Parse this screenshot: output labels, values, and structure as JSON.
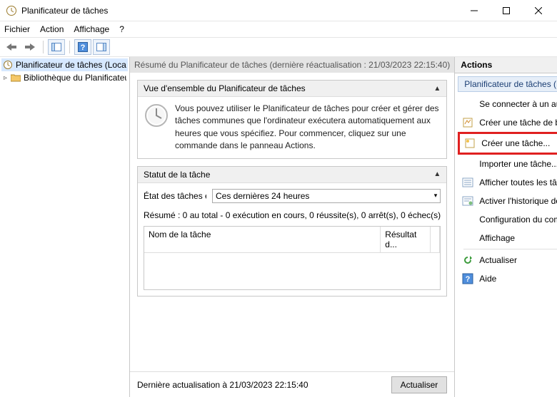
{
  "window": {
    "title": "Planificateur de tâches"
  },
  "menubar": {
    "file": "Fichier",
    "action": "Action",
    "view": "Affichage",
    "help": "?"
  },
  "tree": {
    "root": "Planificateur de tâches (Local)",
    "lib": "Bibliothèque du Planificateur de tâches"
  },
  "center": {
    "summaryHead": "Résumé du Planificateur de tâches (dernière réactualisation : 21/03/2023 22:15:40)",
    "overviewTitle": "Vue d'ensemble du Planificateur de tâches",
    "overviewText": "Vous pouvez utiliser le Planificateur de tâches pour créer et gérer des tâches communes que l'ordinateur exécutera automatiquement aux heures que vous spécifiez. Pour commencer, cliquez sur une commande dans le panneau Actions.",
    "statusTitle": "Statut de la tâche",
    "stateLabel": "État des tâches exécutées :",
    "periodSelected": "Ces dernières 24 heures",
    "summaryLine": "Résumé : 0 au total - 0 exécution en cours, 0 réussite(s), 0 arrêt(s), 0 échec(s)",
    "colName": "Nom de la tâche",
    "colResult": "Résultat d...",
    "lastRefresh": "Dernière actualisation à 21/03/2023 22:15:40",
    "refreshBtn": "Actualiser"
  },
  "actions": {
    "title": "Actions",
    "groupTitle": "Planificateur de tâches (Local)",
    "connect": "Se connecter à un autre ordinateur...",
    "createBasic": "Créer une tâche de base...",
    "createTask": "Créer une tâche...",
    "importTask": "Importer une tâche...",
    "showActive": "Afficher toutes les tâches actives",
    "enableHistory": "Activer l'historique de toutes les tâches",
    "serviceAccount": "Configuration du compte du service…",
    "viewMenu": "Affichage",
    "refresh": "Actualiser",
    "help": "Aide"
  }
}
